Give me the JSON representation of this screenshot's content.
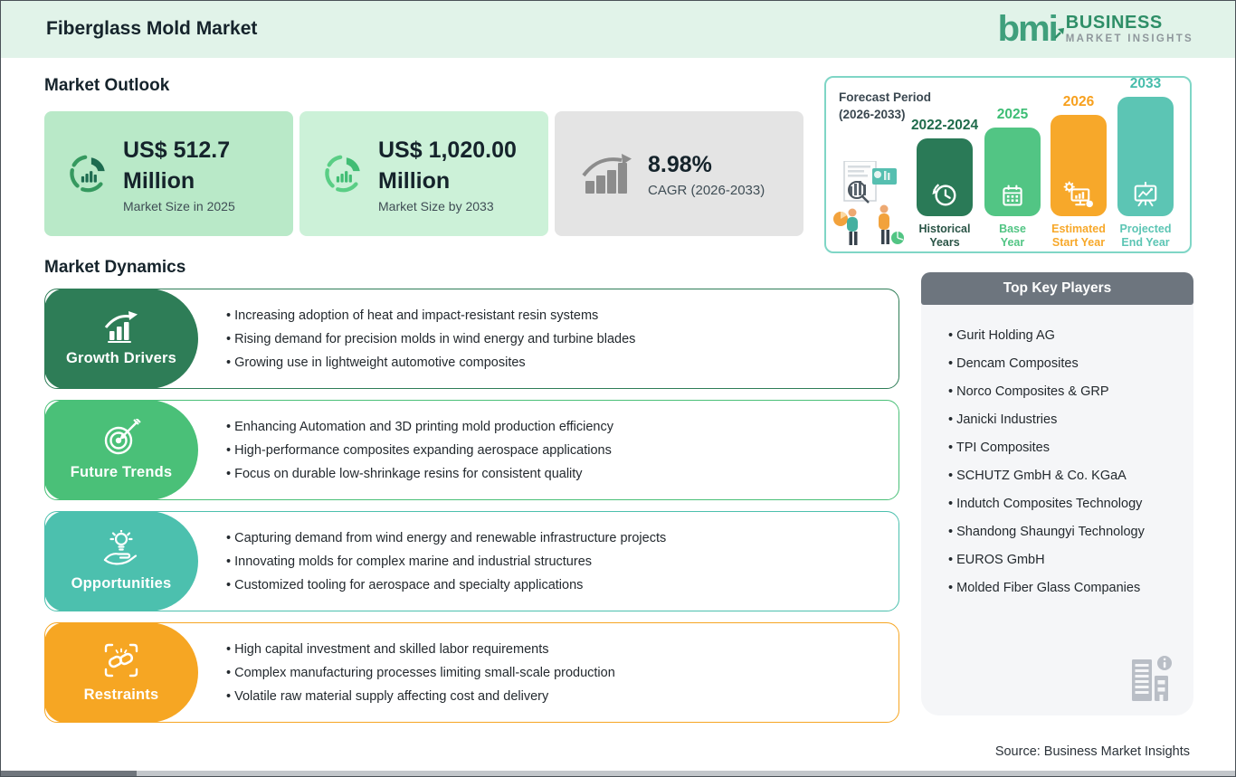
{
  "header": {
    "title": "Fiberglass Mold Market",
    "logo": {
      "mark": "bmi",
      "line1": "BUSINESS",
      "line2": "MARKET INSIGHTS"
    }
  },
  "outlook": {
    "heading": "Market Outlook",
    "cards": [
      {
        "value_line1": "US$ 512.7",
        "value_line2": "Million",
        "caption": "Market Size in 2025",
        "bg_color": "#b9e9c8",
        "icon": "donut-chart-icon"
      },
      {
        "value_line1": "US$ 1,020.00",
        "value_line2": "Million",
        "caption": "Market Size by 2033",
        "bg_color": "#ccf1d8",
        "icon": "donut-chart-icon"
      },
      {
        "value_line1": "8.98%",
        "value_line2": "",
        "caption": "CAGR (2026-2033)",
        "bg_color": "#e4e4e4",
        "icon": "growth-trend-icon"
      }
    ]
  },
  "forecast": {
    "title_line1": "Forecast Period",
    "title_line2": "(2026-2033)",
    "border_color": "#7fd6c6",
    "bars": [
      {
        "year": "2022-2024",
        "label_line1": "Historical",
        "label_line2": "Years",
        "color": "#2a7a57",
        "icon": "history-clock-icon"
      },
      {
        "year": "2025",
        "label_line1": "Base",
        "label_line2": "Year",
        "color": "#52c584",
        "icon": "calendar-icon"
      },
      {
        "year": "2026",
        "label_line1": "Estimated",
        "label_line2": "Start Year",
        "color": "#f7a82a",
        "icon": "gear-monitor-icon"
      },
      {
        "year": "2033",
        "label_line1": "Projected",
        "label_line2": "End Year",
        "color": "#5cc5b4",
        "icon": "presentation-board-icon"
      }
    ]
  },
  "dynamics": {
    "heading": "Market Dynamics",
    "rows": [
      {
        "label": "Growth Drivers",
        "color": "#2e7d57",
        "icon": "bar-growth-icon",
        "bullets": [
          "Increasing adoption of heat and impact-resistant resin systems",
          "Rising demand for precision molds in wind energy and turbine blades",
          "Growing use in lightweight automotive composites"
        ]
      },
      {
        "label": "Future Trends",
        "color": "#4ac078",
        "icon": "target-dart-icon",
        "bullets": [
          "Enhancing Automation and 3D printing mold production efficiency",
          "High-performance composites expanding aerospace applications",
          "Focus on durable low-shrinkage resins for consistent quality"
        ]
      },
      {
        "label": "Opportunities",
        "color": "#4cc0ae",
        "icon": "idea-hand-icon",
        "bullets": [
          "Capturing demand from wind energy and renewable infrastructure projects",
          "Innovating molds for complex marine and industrial structures",
          "Customized tooling for aerospace and specialty applications"
        ]
      },
      {
        "label": "Restraints",
        "color": "#f6a623",
        "icon": "chain-link-icon",
        "bullets": [
          "High capital investment and skilled labor requirements",
          "Complex manufacturing processes limiting small-scale production",
          "Volatile raw material supply affecting cost and delivery"
        ]
      }
    ]
  },
  "players": {
    "heading": "Top Key Players",
    "header_bg": "#6d757e",
    "items": [
      "Gurit Holding AG",
      "Dencam Composites",
      "Norco Composites & GRP",
      "Janicki Industries",
      "TPI Composites",
      "SCHUTZ GmbH & Co. KGaA",
      "Indutch Composites Technology",
      "Shandong Shaungyi Technology",
      "EUROS GmbH",
      "Molded Fiber Glass Companies"
    ]
  },
  "source_note": "Source: Business Market Insights",
  "theme": {
    "header_bg": "#e1f3e9",
    "panel_bg": "#f5f6f8",
    "dark_green": "#2e7d57",
    "green": "#4ac078",
    "teal": "#4cc0ae",
    "orange": "#f6a623",
    "text_dark": "#15232b"
  }
}
